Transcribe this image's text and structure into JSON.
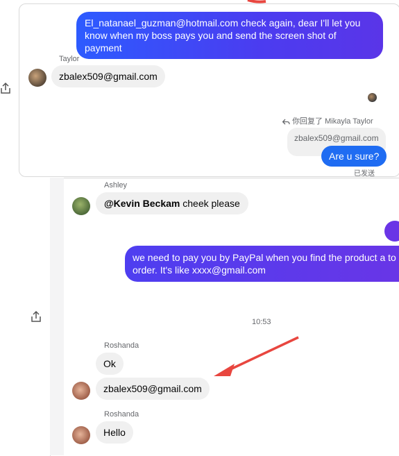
{
  "conversation_top": {
    "outgoing_message": "El_natanael_guzman@hotmail.com   check again, dear I'll let you know when my boss pays you and send the screen shot of payment",
    "sender_name": "Taylor",
    "incoming_message": "zbalex509@gmail.com",
    "reply_note": "你回复了 Mikayla Taylor",
    "quoted_message": "zbalex509@gmail.com",
    "reply_message": "Are u sure?",
    "status": "已发送"
  },
  "conversation_bottom": {
    "ashley_name": "Ashley",
    "ashley_mention": "@Kevin Beckam",
    "ashley_text": " cheek please",
    "outgoing_message": "we need to pay you by PayPal when you find the product a to order. It's like xxxx@gmail.com",
    "timestamp": "10:53",
    "roshanda_name_1": "Roshanda",
    "roshanda_msg_1": "Ok",
    "roshanda_msg_2": "zbalex509@gmail.com",
    "roshanda_name_2": "Roshanda",
    "roshanda_msg_3": "Hello"
  },
  "icons": {
    "share": "share-icon",
    "reply": "reply-icon",
    "annotation": "red-arrow-annotation"
  },
  "colors": {
    "outgoing_bubble": "#2d5bff",
    "incoming_bubble": "#f0f0f0",
    "annotation": "#e8463f"
  }
}
